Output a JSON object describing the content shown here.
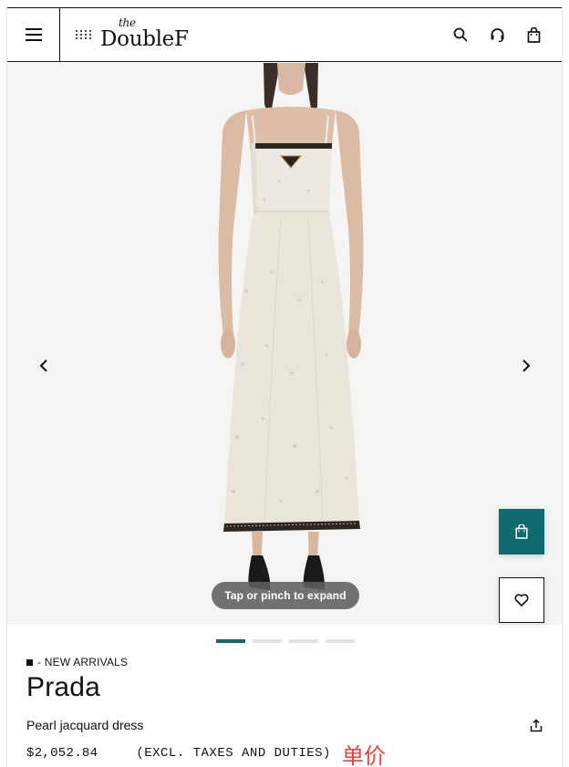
{
  "header": {
    "logo_the": "the",
    "logo_word": "DoubleF"
  },
  "gallery": {
    "expand_hint": "Tap or pinch to expand",
    "slide_count": 4,
    "active_slide": 1
  },
  "product": {
    "tag": "- NEW ARRIVALS",
    "brand": "Prada",
    "name": "Pearl jacquard dress",
    "price": "$2,052.84",
    "tax_note": "(EXCL. TAXES AND DUTIES)",
    "annotation": "单价"
  },
  "colors": {
    "accent": "#0f6b6e",
    "annotation": "#e3413a",
    "image_background": "#f4f4f2"
  },
  "icons": {
    "menu": "hamburger-icon",
    "search": "search-icon",
    "support": "headset-icon",
    "bag": "shopping-bag-icon",
    "prev": "chevron-left-icon",
    "next": "chevron-right-icon",
    "wishlist": "heart-icon",
    "share": "share-icon"
  }
}
